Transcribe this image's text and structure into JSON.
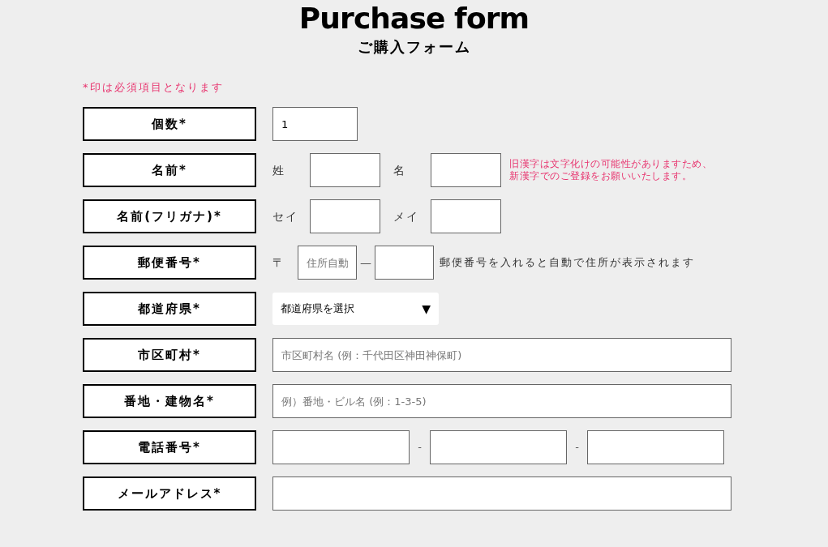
{
  "header": {
    "title": "Purchase form",
    "subtitle": "ご購入フォーム"
  },
  "required_note": "*印は必須項目となります",
  "rows": [
    {
      "kind": "single",
      "label": "個数*",
      "value": "1"
    },
    {
      "kind": "pair",
      "label": "名前*",
      "parts": [
        {
          "label": "姓"
        },
        {
          "label": "名"
        }
      ],
      "note_lines": [
        "旧漢字は文字化けの可能性がありますため、",
        "新漢字でのご登録をお願いいたします。"
      ]
    },
    {
      "kind": "pair",
      "label": "名前(フリガナ)*",
      "parts": [
        {
          "label": "セイ"
        },
        {
          "label": "メイ"
        }
      ]
    },
    {
      "kind": "postal",
      "label": "郵便番号*",
      "prefix": "〒",
      "placeholder": "住所自動",
      "separator": "—",
      "hint": "郵便番号を入れると自動で住所が表示されます"
    },
    {
      "kind": "select",
      "label": "都道府県*",
      "value": "都道府県を選択",
      "arrow": "▼"
    },
    {
      "kind": "full",
      "label": "市区町村*",
      "placeholder": "市区町村名 (例：千代田区神田神保町)"
    },
    {
      "kind": "full",
      "label": "番地・建物名*",
      "placeholder": "例）番地・ビル名 (例：1-3-5)"
    },
    {
      "kind": "phone",
      "label": "電話番号*",
      "separators": [
        "-",
        "-"
      ]
    },
    {
      "kind": "full",
      "label": "メールアドレス*"
    }
  ]
}
